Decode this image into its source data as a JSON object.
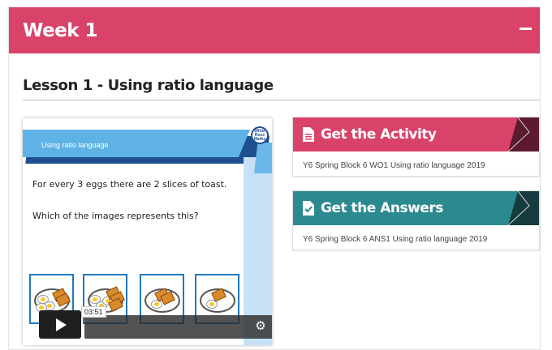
{
  "week": {
    "title": "Week 1"
  },
  "lesson": {
    "title": "Lesson 1 - Using ratio language"
  },
  "video": {
    "slide_title": "Using ratio language",
    "question_line1": "For every 3 eggs there are 2 slices of toast.",
    "question_line2": "Which of the images represents this?",
    "logo_text": "White Rose Maths",
    "duration": "03:51"
  },
  "activity": {
    "button_label": "Get the Activity",
    "file_name": "Y6 Spring Block 6 WO1 Using ratio language 2019",
    "color": "#d9436a"
  },
  "answers": {
    "button_label": "Get the Answers",
    "file_name": "Y6 Spring Block 6 ANS1 Using ratio language 2019",
    "color": "#2b8a8f"
  },
  "colors": {
    "accent": "#d9436a",
    "teal": "#2b8a8f",
    "slide_blue": "#5fb2e6",
    "navy": "#1d4f91"
  }
}
